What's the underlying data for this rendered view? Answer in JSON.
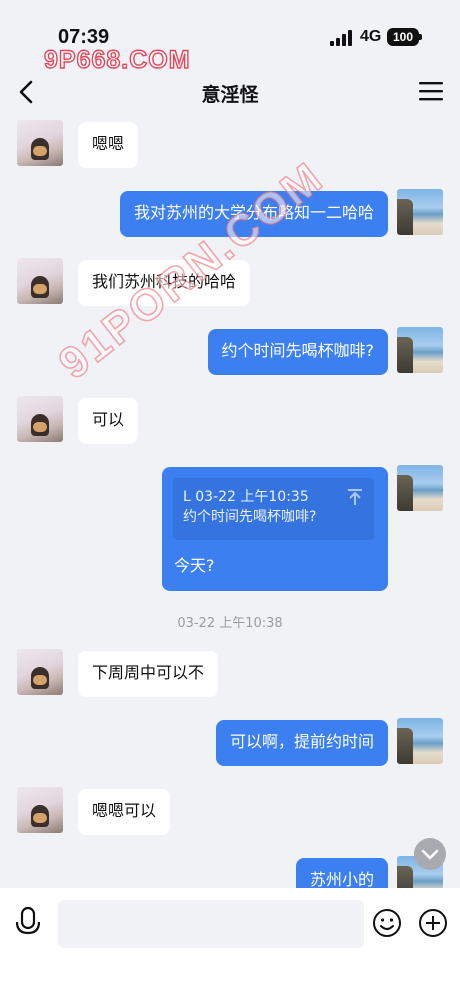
{
  "status": {
    "time": "07:39",
    "network": "4G",
    "battery": "100"
  },
  "watermarks": {
    "top": "9P668.COM",
    "diagonal": "91PORN.COM"
  },
  "header": {
    "title": "意淫怪"
  },
  "messages": [
    {
      "side": "left",
      "text": "嗯嗯"
    },
    {
      "side": "right",
      "text": "我对苏州的大学分布略知一二哈哈"
    },
    {
      "side": "left",
      "text": "我们苏州科技的哈哈"
    },
    {
      "side": "right",
      "text": "约个时间先喝杯咖啡?"
    },
    {
      "side": "left",
      "text": "可以"
    },
    {
      "side": "right",
      "quote_header": "L 03-22 上午10:35",
      "quote_text": "约个时间先喝杯咖啡?",
      "text": "今天?"
    },
    {
      "side": "left",
      "text": "下周周中可以不"
    },
    {
      "side": "right",
      "text": "可以啊，提前约时间"
    },
    {
      "side": "left",
      "text": "嗯嗯可以"
    },
    {
      "side": "right",
      "text": "苏州小的"
    }
  ],
  "timestamp": "03-22 上午10:38",
  "input": {
    "placeholder": ""
  },
  "colors": {
    "accent": "#3b7ff0",
    "background": "#f1f2f6"
  }
}
